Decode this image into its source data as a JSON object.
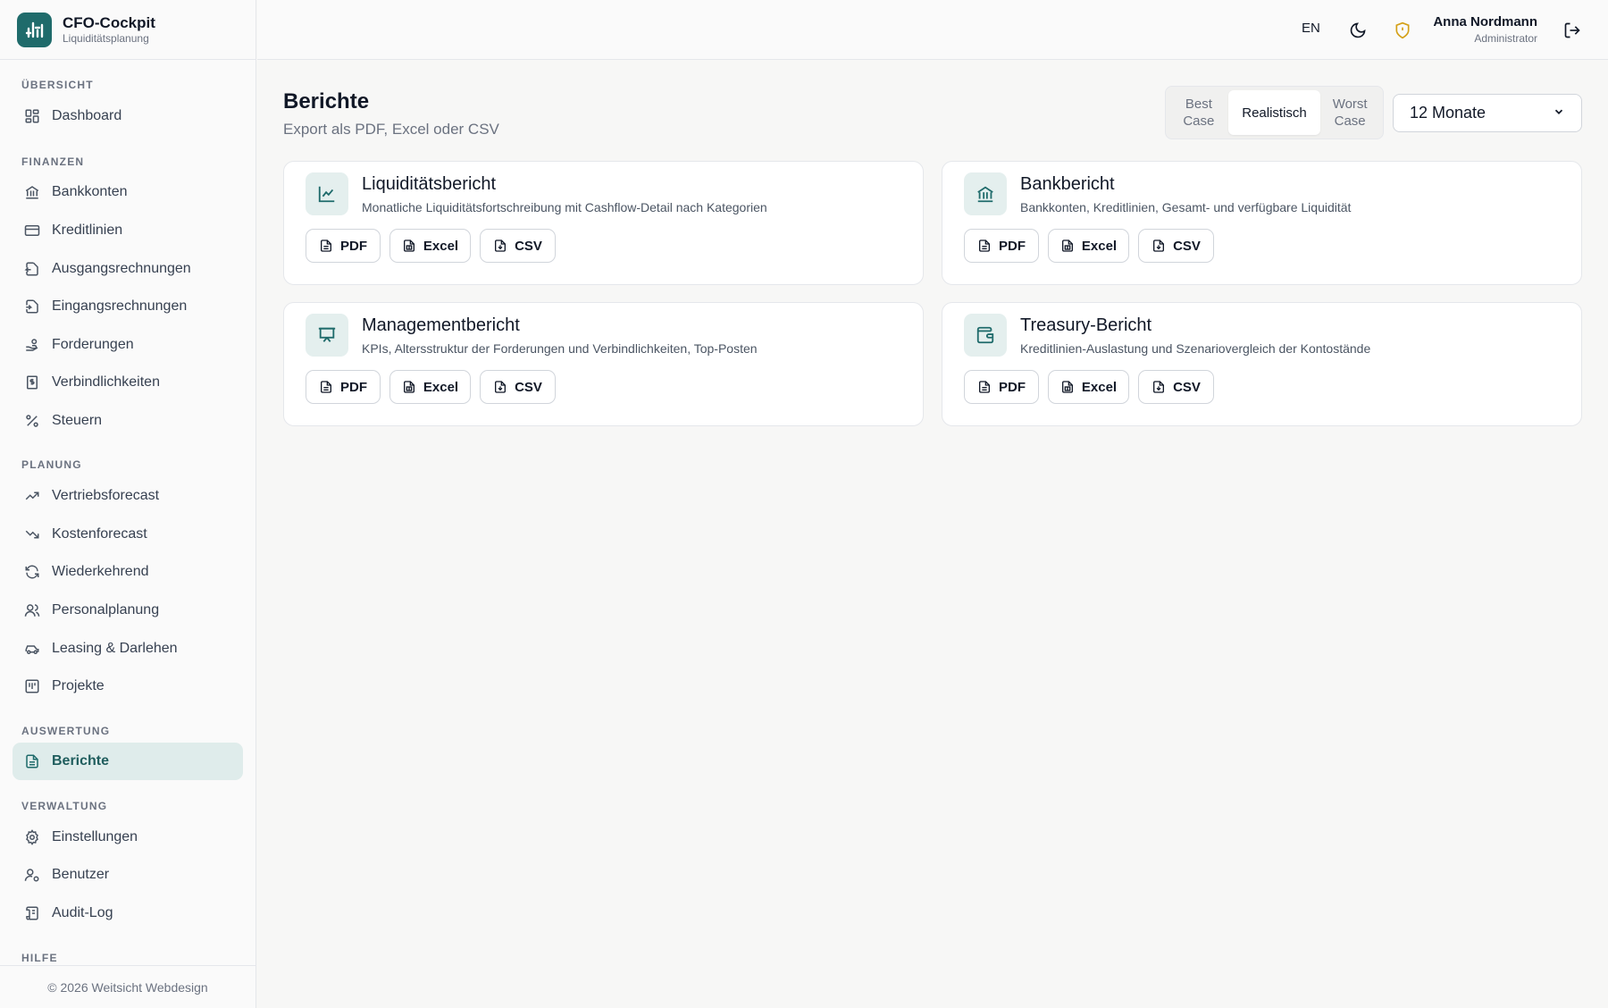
{
  "brand": {
    "title": "CFO-Cockpit",
    "subtitle": "Liquiditätsplanung"
  },
  "sidebar": {
    "sections": {
      "overview": "ÜBERSICHT",
      "finance": "FINANZEN",
      "planning": "PLANUNG",
      "evaluation": "AUSWERTUNG",
      "admin": "VERWALTUNG",
      "help": "HILFE"
    },
    "items": {
      "dashboard": "Dashboard",
      "bank_accounts": "Bankkonten",
      "credit_lines": "Kreditlinien",
      "outgoing_invoices": "Ausgangsrechnungen",
      "incoming_invoices": "Eingangsrechnungen",
      "receivables": "Forderungen",
      "liabilities": "Verbindlichkeiten",
      "taxes": "Steuern",
      "sales_forecast": "Vertriebsforecast",
      "cost_forecast": "Kostenforecast",
      "recurring": "Wiederkehrend",
      "personnel": "Personalplanung",
      "leasing": "Leasing & Darlehen",
      "projects": "Projekte",
      "reports": "Berichte",
      "settings": "Einstellungen",
      "users": "Benutzer",
      "audit_log": "Audit-Log"
    },
    "footer": "© 2026 Weitsicht Webdesign"
  },
  "topbar": {
    "language": "EN",
    "user_name": "Anna Nordmann",
    "user_role": "Administrator"
  },
  "page": {
    "title": "Berichte",
    "subtitle": "Export als PDF, Excel oder CSV"
  },
  "scenario": {
    "best_line1": "Best",
    "best_line2": "Case",
    "realistic": "Realistisch",
    "worst_line1": "Worst",
    "worst_line2": "Case",
    "selected": "Realistisch"
  },
  "period": {
    "selected": "12 Monate"
  },
  "reports": [
    {
      "title": "Liquiditätsbericht",
      "description": "Monatliche Liquiditätsfortschreibung mit Cashflow-Detail nach Kategorien",
      "icon": "line-chart-icon"
    },
    {
      "title": "Bankbericht",
      "description": "Bankkonten, Kreditlinien, Gesamt- und verfügbare Liquidität",
      "icon": "bank-icon"
    },
    {
      "title": "Managementbericht",
      "description": "KPIs, Altersstruktur der Forderungen und Verbindlichkeiten, Top-Posten",
      "icon": "presentation-icon"
    },
    {
      "title": "Treasury-Bericht",
      "description": "Kreditlinien-Auslastung und Szenariovergleich der Kontostände",
      "icon": "wallet-icon"
    }
  ],
  "export": {
    "pdf": "PDF",
    "excel": "Excel",
    "csv": "CSV"
  },
  "colors": {
    "accent": "#1f6b6b",
    "active_bg": "#dfeceb",
    "warning": "#d4a017"
  }
}
